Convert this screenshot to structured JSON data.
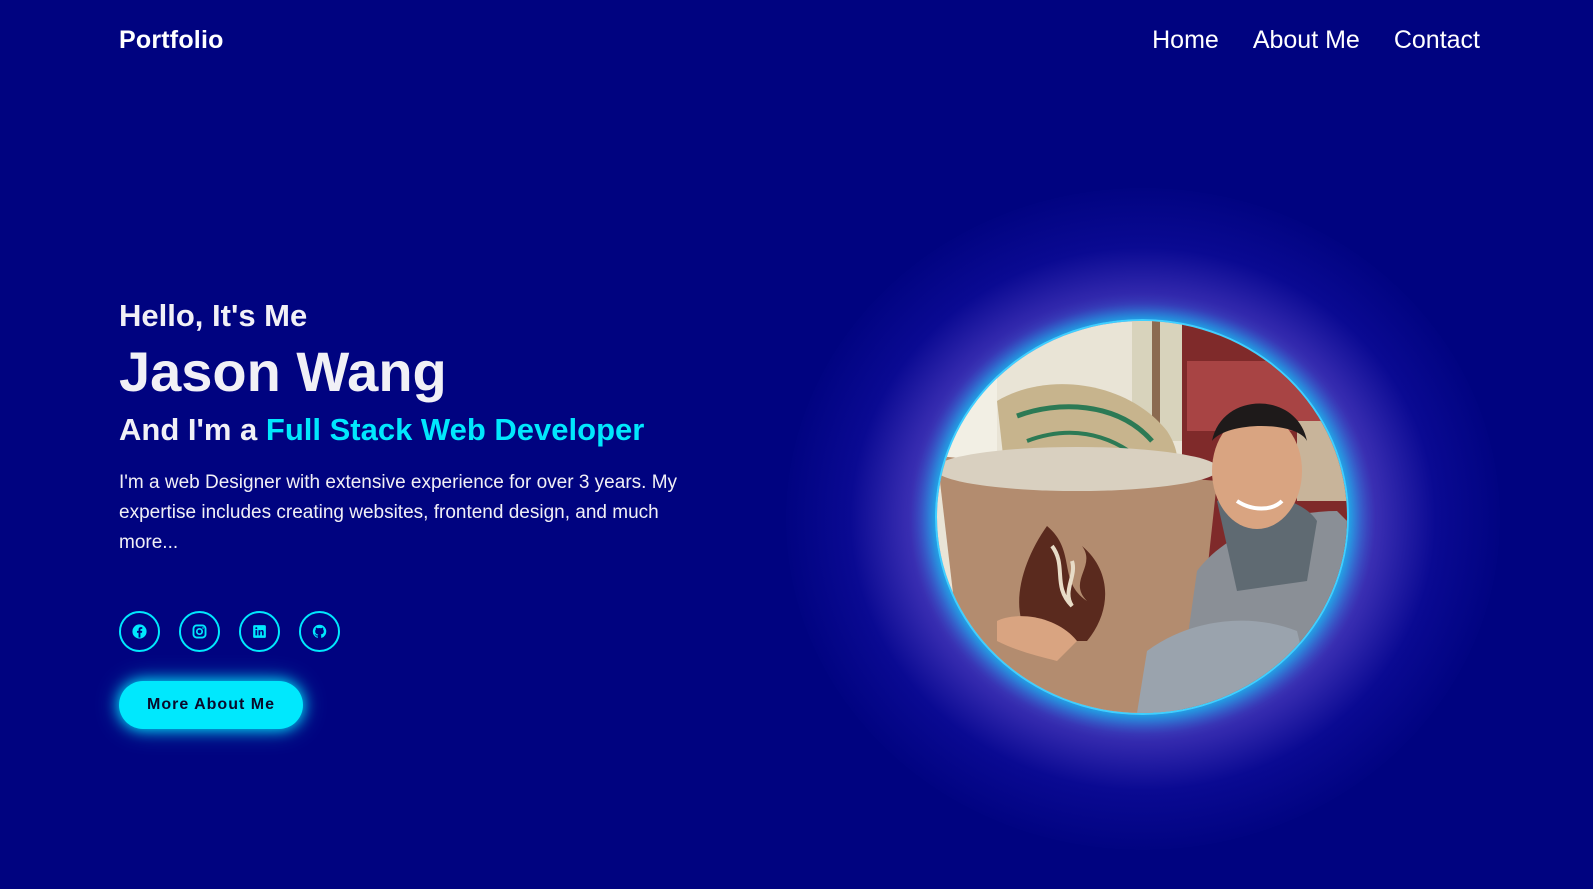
{
  "header": {
    "logo": "Portfolio",
    "nav": [
      {
        "label": "Home"
      },
      {
        "label": "About Me"
      },
      {
        "label": "Contact"
      }
    ]
  },
  "hero": {
    "greeting": "Hello, It's Me",
    "name": "Jason Wang",
    "role_prefix": "And I'm a ",
    "role_highlight": "Full Stack Web Developer",
    "description": "I'm a web Designer with extensive experience for over 3 years. My expertise includes creating websites, frontend design, and much more...",
    "socials": [
      {
        "icon": "facebook-icon"
      },
      {
        "icon": "instagram-icon"
      },
      {
        "icon": "linkedin-icon"
      },
      {
        "icon": "github-icon"
      }
    ],
    "cta_label": "More About Me",
    "photo_alt": "Jason Wang"
  },
  "colors": {
    "background": "#000380",
    "accent": "#00e8fd",
    "text": "#f1f0f6"
  }
}
